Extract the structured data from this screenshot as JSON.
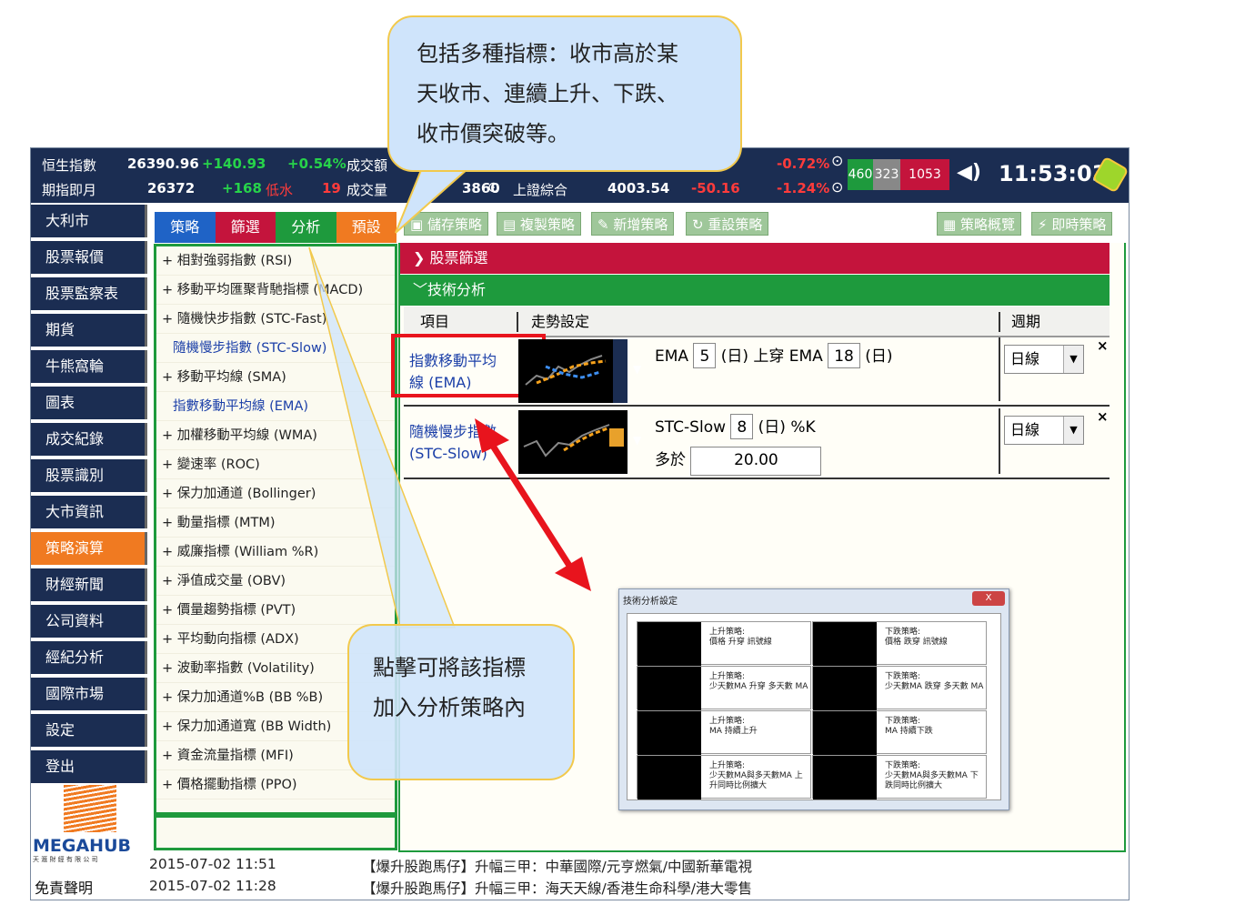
{
  "callouts": {
    "top": [
      "包括多種指標：收市高於某",
      "天收市、連續上升、下跌、",
      "收市價突破等。"
    ],
    "middle": [
      "點擊可將該指標",
      "加入分析策略內"
    ]
  },
  "ticker": {
    "row1": {
      "name": "恒生指數",
      "value": "26390.96",
      "change": "+140.93",
      "pct": "+0.54%",
      "vol_label": "成交額",
      "pct2": "-0.72%"
    },
    "row2": {
      "name": "期指即月",
      "value": "26372",
      "change": "+168",
      "low_label": "低水",
      "low_value": "19",
      "vol_label": "成交量",
      "partial": "3860",
      "sh_name": "上證綜合",
      "sh_value": "4003.54",
      "sh_change": "-50.16",
      "sh_pct": "-1.24%"
    },
    "counts": {
      "up": "460",
      "flat": "323",
      "down": "1053"
    },
    "clock": "11:53:03"
  },
  "sidebar": {
    "items": [
      "大利市",
      "股票報價",
      "股票監察表",
      "期貨",
      "牛熊窩輪",
      "圖表",
      "成交紀錄",
      "股票識別",
      "大市資訊",
      "策略演算",
      "財經新聞",
      "公司資料",
      "經紀分析",
      "國際市場",
      "設定",
      "登出"
    ],
    "active_index": 9,
    "logo_text": "MEGAHUB",
    "logo_sub": "天 滙 財 經 有 限 公 司",
    "disclaimer": "免責聲明"
  },
  "tabs": [
    {
      "label": "策略",
      "color": "#1f63c6"
    },
    {
      "label": "篩選",
      "color": "#c4143c"
    },
    {
      "label": "分析",
      "color": "#1e9a3d"
    },
    {
      "label": "預設",
      "color": "#f07a21"
    }
  ],
  "indicators": [
    {
      "label": "+ 相對強弱指數 (RSI)",
      "selected": false
    },
    {
      "label": "+ 移動平均匯聚背馳指標 (MACD)",
      "selected": false
    },
    {
      "label": "+ 隨機快步指數 (STC-Fast)",
      "selected": false
    },
    {
      "label": "隨機慢步指數 (STC-Slow)",
      "selected": true
    },
    {
      "label": "+ 移動平均線 (SMA)",
      "selected": false
    },
    {
      "label": "指數移動平均線 (EMA)",
      "selected": true
    },
    {
      "label": "+ 加權移動平均線 (WMA)",
      "selected": false
    },
    {
      "label": "+ 變速率 (ROC)",
      "selected": false
    },
    {
      "label": "+ 保力加通道 (Bollinger)",
      "selected": false
    },
    {
      "label": "+ 動量指標 (MTM)",
      "selected": false
    },
    {
      "label": "+ 威廉指標 (William %R)",
      "selected": false
    },
    {
      "label": "+ 淨值成交量 (OBV)",
      "selected": false
    },
    {
      "label": "+ 價量趨勢指標 (PVT)",
      "selected": false
    },
    {
      "label": "+ 平均動向指標 (ADX)",
      "selected": false
    },
    {
      "label": "+ 波動率指數 (Volatility)",
      "selected": false
    },
    {
      "label": "+ 保力加通道%B (BB %B)",
      "selected": false
    },
    {
      "label": "+ 保力加通道寬 (BB Width)",
      "selected": false
    },
    {
      "label": "+ 資金流量指標 (MFI)",
      "selected": false
    },
    {
      "label": "+ 價格擺動指標 (PPO)",
      "selected": false
    }
  ],
  "toolbar": {
    "save": "儲存策略",
    "copy": "複製策略",
    "add": "新增策略",
    "reset": "重設策略",
    "overview": "策略概覽",
    "instant": "即時策略"
  },
  "sections": {
    "screening": "股票篩選",
    "technical": "技術分析"
  },
  "columns": {
    "item": "項目",
    "trend": "走勢設定",
    "period": "週期"
  },
  "rows": [
    {
      "name_line1": "指數移動平均",
      "name_line2": "線 (EMA)",
      "text1": "EMA",
      "val1": "5",
      "unit1": "(日)",
      "op": "上穿",
      "text2": "EMA",
      "val2": "18",
      "unit2": "(日)",
      "period": "日線",
      "close": "×"
    },
    {
      "name_line1": "隨機慢步指數",
      "name_line2": "(STC-Slow)",
      "text1": "STC-Slow",
      "val1": "8",
      "unit1": "(日) %K",
      "op_label": "多於",
      "op_value": "20.00",
      "period": "日線",
      "close": "×"
    }
  ],
  "dialog": {
    "title": "技術分析設定",
    "close": "X",
    "cells": [
      {
        "head": "上升策略:",
        "body": "價格 升穿 訊號線"
      },
      {
        "head": "下跌策略:",
        "body": "價格 跌穿 訊號線"
      },
      {
        "head": "上升策略:",
        "body": "少天數MA 升穿 多天數 MA"
      },
      {
        "head": "下跌策略:",
        "body": "少天數MA 跌穿 多天數 MA"
      },
      {
        "head": "上升策略:",
        "body": "MA 持續上升"
      },
      {
        "head": "下跌策略:",
        "body": "MA 持續下跌"
      },
      {
        "head": "上升策略:",
        "body": "少天數MA與多天數MA 上升同時比例擴大"
      },
      {
        "head": "下跌策略:",
        "body": "少天數MA與多天數MA 下跌同時比例擴大"
      }
    ]
  },
  "news": [
    {
      "time": "2015-07-02 11:51",
      "text": "【爆升股跑馬仔】升幅三甲：中華國際/元亨燃氣/中國新華電視"
    },
    {
      "time": "2015-07-02 11:28",
      "text": "【爆升股跑馬仔】升幅三甲：海天天線/香港生命科學/港大零售"
    }
  ]
}
